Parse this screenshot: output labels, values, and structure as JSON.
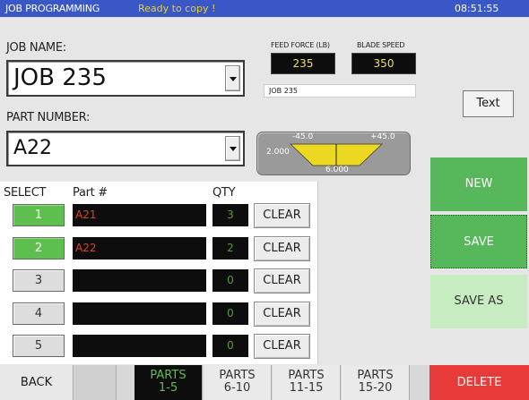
{
  "titlebar": {
    "app": "JOB PROGRAMMING",
    "status": "Ready to copy !",
    "clock": "08:51:55"
  },
  "job": {
    "label": "JOB NAME:",
    "value": "JOB 235"
  },
  "part": {
    "label": "PART NUMBER:",
    "value": "A22"
  },
  "feed": {
    "label": "FEED FORCE (LB)",
    "value": "235"
  },
  "blade": {
    "label": "BLADE SPEED",
    "value": "350"
  },
  "job_strip": "JOB 235",
  "gauge": {
    "left_angle": "-45.0",
    "right_angle": "+45.0",
    "left_len": "2.000",
    "bottom_len": "6.000"
  },
  "text_button": "Text",
  "table": {
    "headers": {
      "select": "SELECT",
      "part": "Part #",
      "qty": "QTY"
    },
    "rows": [
      {
        "num": "1",
        "part": "A21",
        "qty": "3",
        "clear": "CLEAR"
      },
      {
        "num": "2",
        "part": "A22",
        "qty": "2",
        "clear": "CLEAR"
      },
      {
        "num": "3",
        "part": "",
        "qty": "0",
        "clear": "CLEAR"
      },
      {
        "num": "4",
        "part": "",
        "qty": "0",
        "clear": "CLEAR"
      },
      {
        "num": "5",
        "part": "",
        "qty": "0",
        "clear": "CLEAR"
      }
    ]
  },
  "side": {
    "new": "NEW",
    "save": "SAVE",
    "save_as": "SAVE AS"
  },
  "bottom": {
    "back": "BACK",
    "pages": [
      {
        "top": "PARTS",
        "bottom": "1-5"
      },
      {
        "top": "PARTS",
        "bottom": "6-10"
      },
      {
        "top": "PARTS",
        "bottom": "11-15"
      },
      {
        "top": "PARTS",
        "bottom": "15-20"
      }
    ],
    "delete": "DELETE"
  },
  "colors": {
    "title_bar": "#3a57c8",
    "status_text": "#e8d22a",
    "green": "#56b85a",
    "delete": "#e93a3a",
    "gauge_fill": "#ecd820"
  }
}
